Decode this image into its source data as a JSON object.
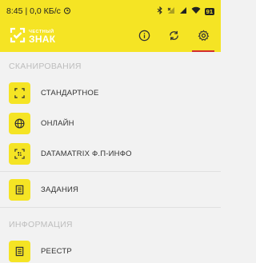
{
  "status_bar": {
    "time": "8:45",
    "network_speed": "0,0 КБ/с",
    "battery": "91"
  },
  "app_bar": {
    "logo_small": "ЧЕСТНЫЙ",
    "logo_big": "ЗНАК",
    "actions": [
      "info-icon",
      "sync-icon",
      "settings-icon"
    ]
  },
  "sections": {
    "scanning": {
      "header": "СКАНИРОВАНИЯ",
      "items": [
        {
          "label": "СТАНДАРТНОЕ",
          "icon": "scan-frame-icon"
        },
        {
          "label": "ОНЛАЙН",
          "icon": "globe-icon"
        },
        {
          "label": "DATAMATRIX Ф.П-ИНФО",
          "icon": "datamatrix-scan-icon"
        }
      ]
    },
    "tasks": {
      "items": [
        {
          "label": "ЗАДАНИЯ",
          "icon": "document-icon"
        }
      ]
    },
    "info": {
      "header": "ИНФОРМАЦИЯ",
      "items": [
        {
          "label": "РЕЕСТР",
          "icon": "document-icon"
        }
      ]
    }
  },
  "colors": {
    "accent": "#f5e424",
    "background": "#f2f2f2",
    "active_underline": "#d32f2f"
  }
}
